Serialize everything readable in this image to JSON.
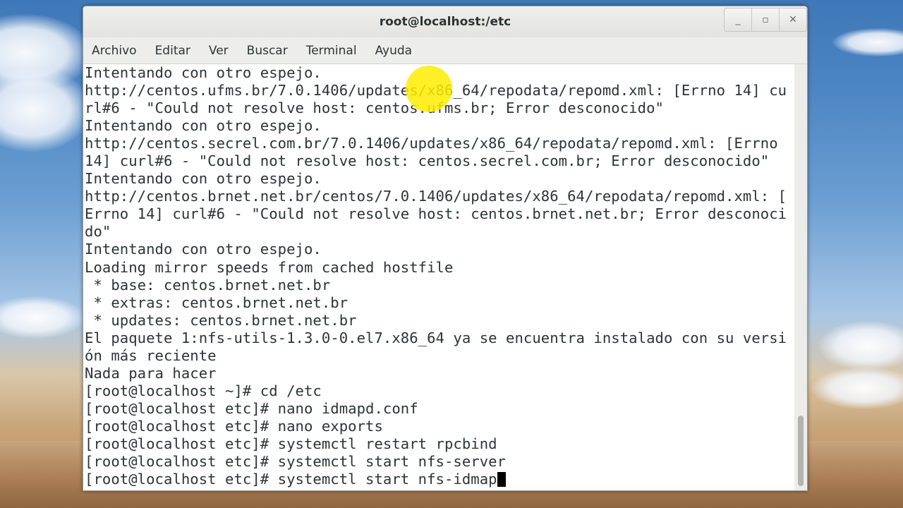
{
  "window": {
    "title": "root@localhost:/etc",
    "controls": [
      "_",
      "▫",
      "✕"
    ]
  },
  "menubar": {
    "items": [
      "Archivo",
      "Editar",
      "Ver",
      "Buscar",
      "Terminal",
      "Ayuda"
    ]
  },
  "terminal": {
    "lines": [
      "Intentando con otro espejo.",
      "http://centos.ufms.br/7.0.1406/updates/x86_64/repodata/repomd.xml: [Errno 14] cu",
      "rl#6 - \"Could not resolve host: centos.ufms.br; Error desconocido\"",
      "Intentando con otro espejo.",
      "http://centos.secrel.com.br/7.0.1406/updates/x86_64/repodata/repomd.xml: [Errno",
      "14] curl#6 - \"Could not resolve host: centos.secrel.com.br; Error desconocido\"",
      "Intentando con otro espejo.",
      "http://centos.brnet.net.br/centos/7.0.1406/updates/x86_64/repodata/repomd.xml: [",
      "Errno 14] curl#6 - \"Could not resolve host: centos.brnet.net.br; Error desconoci",
      "do\"",
      "Intentando con otro espejo.",
      "Loading mirror speeds from cached hostfile",
      " * base: centos.brnet.net.br",
      " * extras: centos.brnet.net.br",
      " * updates: centos.brnet.net.br",
      "El paquete 1:nfs-utils-1.3.0-0.el7.x86_64 ya se encuentra instalado con su versi",
      "ón más reciente",
      "Nada para hacer",
      "[root@localhost ~]# cd /etc",
      "[root@localhost etc]# nano idmapd.conf",
      "[root@localhost etc]# nano exports",
      "[root@localhost etc]# systemctl restart rpcbind",
      "[root@localhost etc]# systemctl start nfs-server"
    ],
    "current_input": "[root@localhost etc]# systemctl start nfs-idmap"
  }
}
